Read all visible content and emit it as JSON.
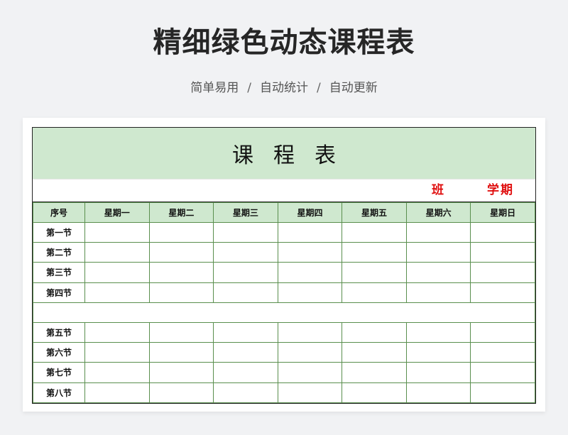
{
  "header": {
    "title": "精细绿色动态课程表",
    "tags": [
      "简单易用",
      "自动统计",
      "自动更新"
    ],
    "separator": "/"
  },
  "sheet": {
    "banner_title": "课程表",
    "class_label": "班",
    "term_label": "学期",
    "columns": [
      "序号",
      "星期一",
      "星期二",
      "星期三",
      "星期四",
      "星期五",
      "星期六",
      "星期日"
    ],
    "morning_periods": [
      "第一节",
      "第二节",
      "第三节",
      "第四节"
    ],
    "afternoon_periods": [
      "第五节",
      "第六节",
      "第七节",
      "第八节"
    ]
  },
  "colors": {
    "header_fill": "#cfe8cf",
    "grid_line": "#5a8f4e",
    "accent_red": "#e01010"
  }
}
